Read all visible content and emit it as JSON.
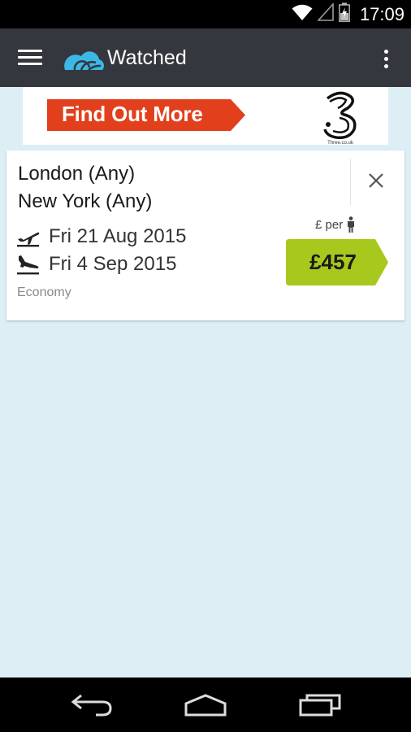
{
  "status_bar": {
    "time": "17:09",
    "icons": [
      "wifi-icon",
      "signal-icon",
      "battery-charging-icon"
    ]
  },
  "app_bar": {
    "title": "Watched",
    "icons": [
      "menu-icon",
      "skyscanner-logo-icon",
      "overflow-menu-icon"
    ]
  },
  "ad": {
    "cta_label": "Find Out More",
    "brand_caption": "Three.co.uk",
    "cta_color": "#e2401c"
  },
  "watched_flight": {
    "origin": "London (Any)",
    "destination": "New York (Any)",
    "outbound_date": "Fri 21 Aug 2015",
    "return_date": "Fri 4 Sep 2015",
    "cabin_class": "Economy",
    "per_label": "£ per",
    "price": "£457",
    "price_color": "#a7c81c",
    "icons": [
      "takeoff-icon",
      "landing-icon",
      "close-icon",
      "person-icon"
    ]
  },
  "nav_bar": {
    "icons": [
      "back-icon",
      "home-icon",
      "recents-icon"
    ]
  },
  "colors": {
    "background": "#ddeef5",
    "app_bar": "#34383e",
    "accent": "#3cb8e6"
  }
}
